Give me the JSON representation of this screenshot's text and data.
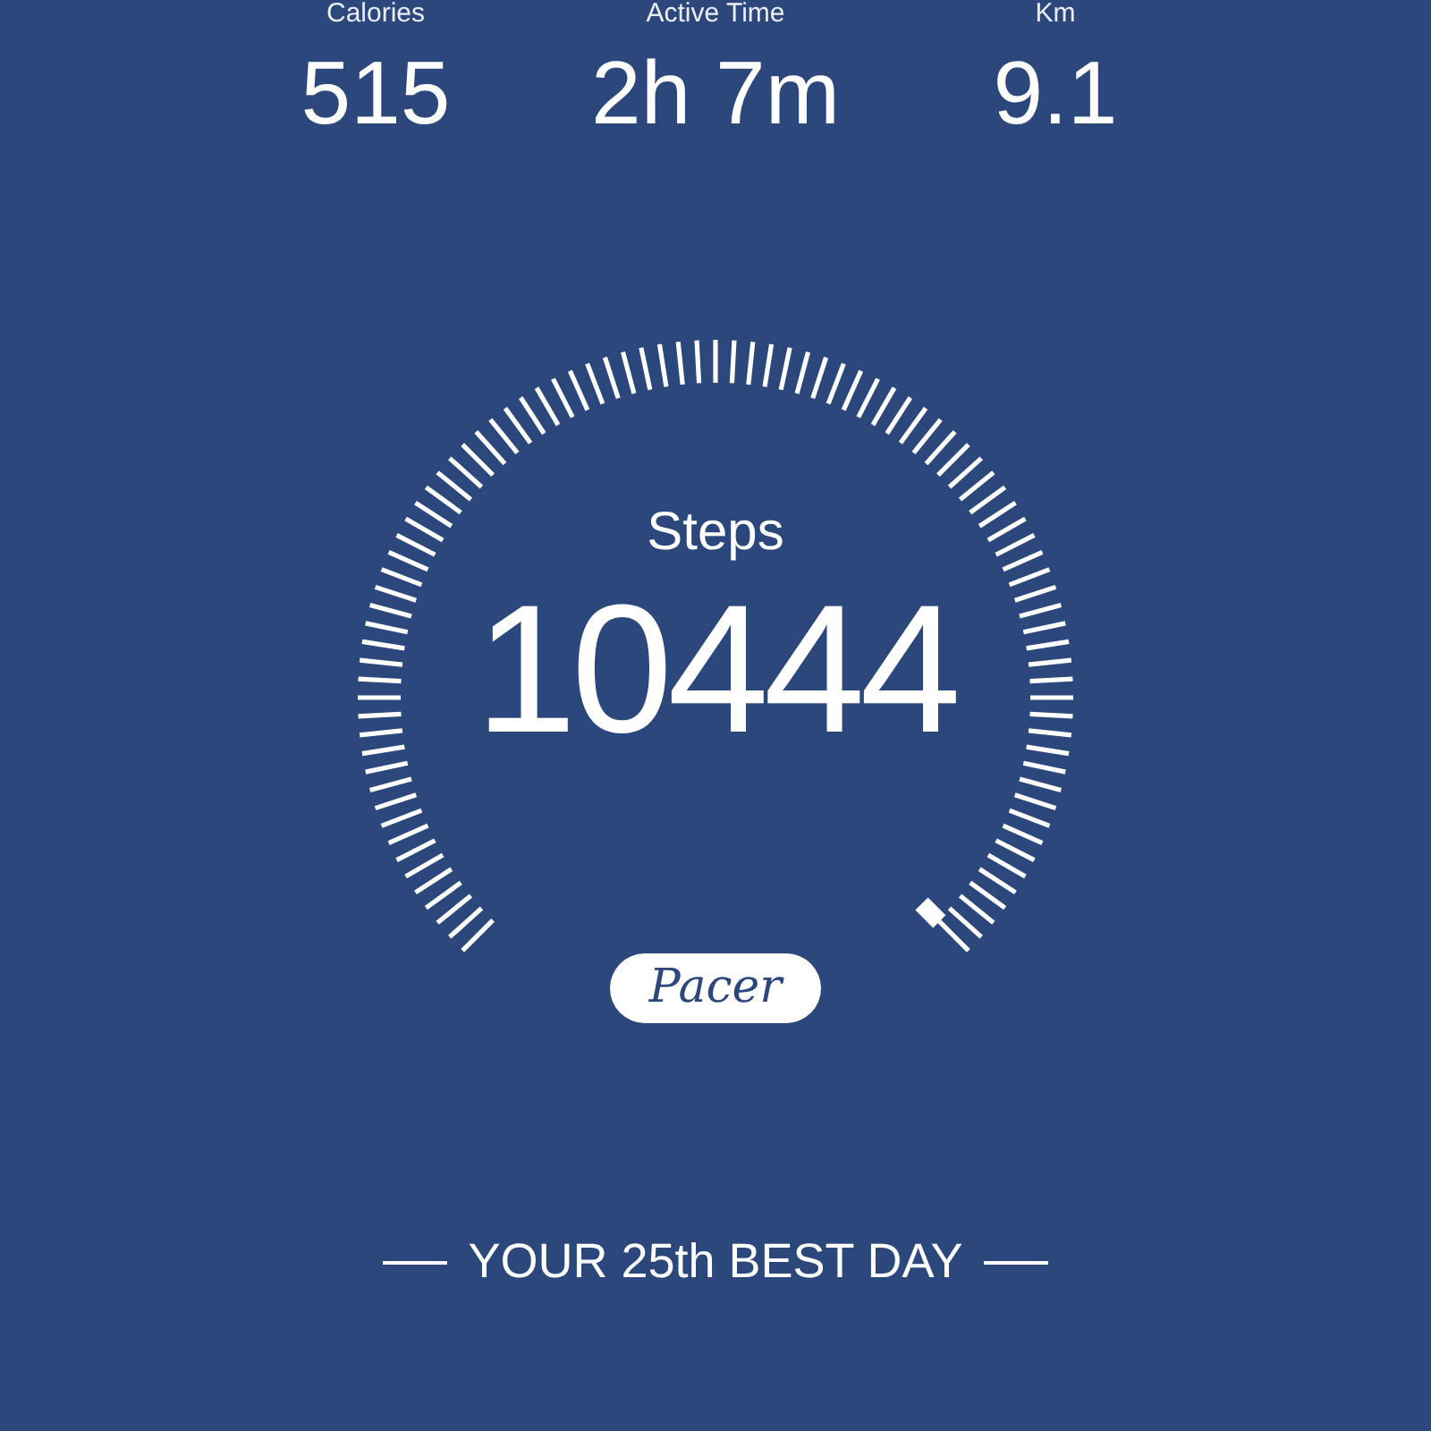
{
  "stats": [
    {
      "label": "Calories",
      "value": "515"
    },
    {
      "label": "Active Time",
      "value": "2h 7m"
    },
    {
      "label": "Km",
      "value": "9.1"
    }
  ],
  "steps": {
    "label": "Steps",
    "value": "10444"
  },
  "logo": "Pacer",
  "ranking": "YOUR 25th BEST DAY"
}
